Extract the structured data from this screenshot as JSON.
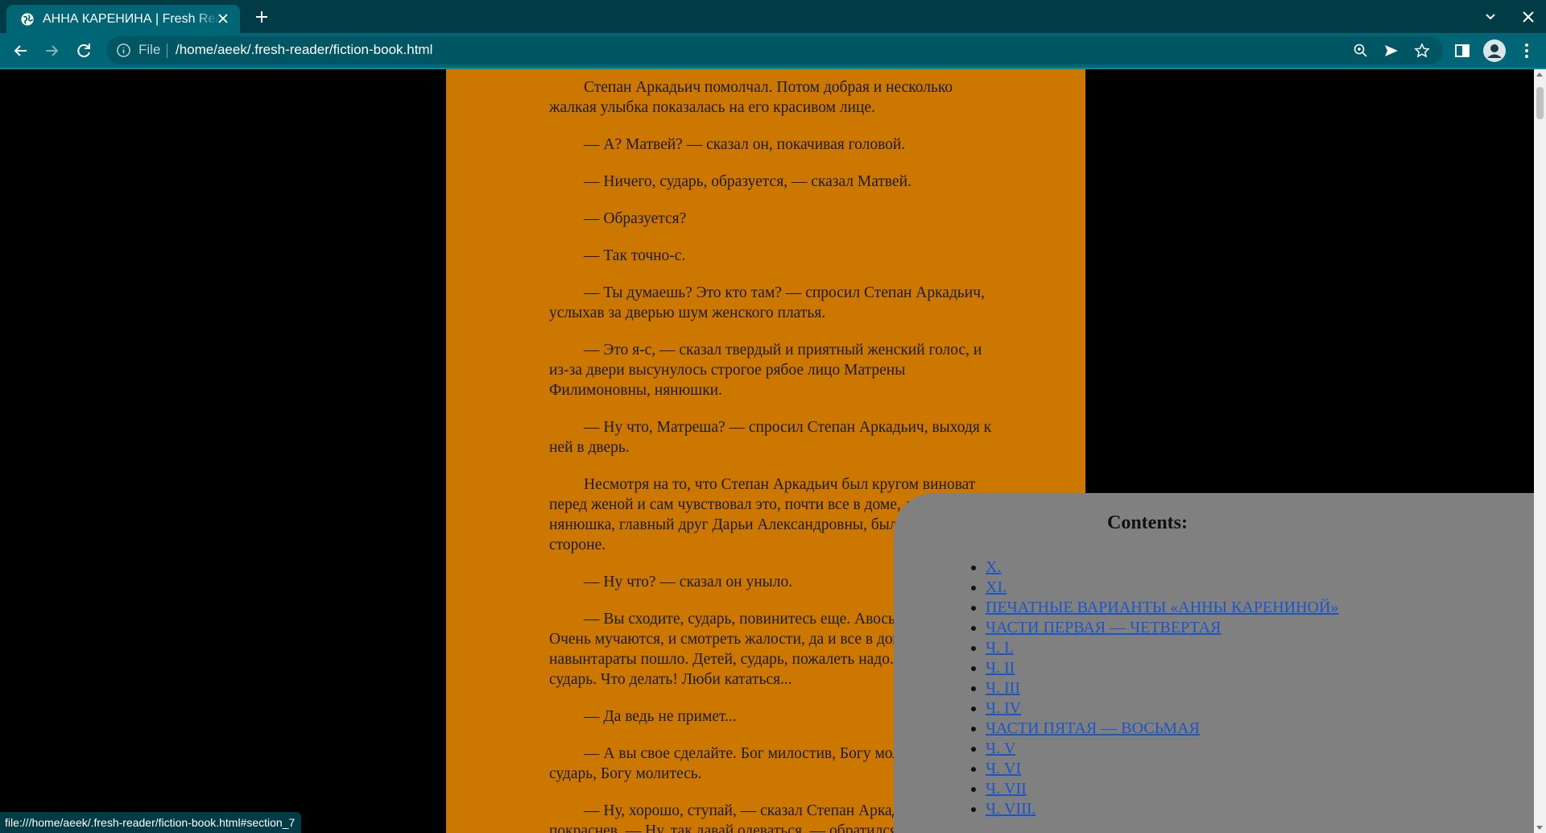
{
  "browser": {
    "tab_title": "АННА КАРЕНИНА | Fresh Reader",
    "address_scheme": "File",
    "address_url": "/home/aeek/.fresh-reader/fiction-book.html",
    "status_url": "file:///home/aeek/.fresh-reader/fiction-book.html#section_7"
  },
  "book": {
    "paragraphs": [
      "Степан Аркадьич помолчал. Потом добрая и несколько жалкая улыбка показалась на его красивом лице.",
      "— А? Матвей? — сказал он, покачивая головой.",
      "— Ничего, сударь, образуется, — сказал Матвей.",
      "— Образуется?",
      "— Так точно-с.",
      "— Ты думаешь? Это кто там? — спросил Степан Аркадьич, услыхав за дверью шум женского платья.",
      "— Это я-с, — сказал твердый и приятный женский голос, и из-за двери высунулось строгое рябое лицо Матрены Филимоновны, нянюшки.",
      "— Ну что, Матреша? — спросил Степан Аркадьич, выходя к ней в дверь.",
      "Несмотря на то, что Степан Аркадьич был кругом виноват перед женой и сам чувствовал это, почти все в доме, даже нянюшка, главный друг Дарьи Александровны, были на его стороне.",
      "— Ну что? — сказал он уныло.",
      "— Вы сходите, сударь, повинитесь еще. Авось бог даст. Очень мучаются, и смотреть жалости, да и все в доме навынтараты пошло. Детей, сударь, пожалеть надо. Повинитесь, сударь. Что делать! Люби кататься...",
      "— Да ведь не примет...",
      "— А вы свое сделайте. Бог милостив, Богу молитесь, сударь, Богу молитесь.",
      "— Ну, хорошо, ступай, — сказал Степан Аркадьич, вдруг покраснев. — Ну, так давай одеваться, — обратился он к Матвею."
    ]
  },
  "toc": {
    "title": "Contents:",
    "items": [
      "X.",
      "XI.",
      "ПЕЧАТНЫЕ ВАРИАНТЫ «АННЫ КАРЕНИНОЙ»",
      "ЧАСТИ ПЕРВАЯ — ЧЕТВЕРТАЯ",
      "Ч. I.",
      "Ч. II",
      "Ч. III",
      "Ч. IV",
      "ЧАСТИ ПЯТАЯ — ВОСЬМАЯ",
      "Ч. V",
      "Ч. VI",
      "Ч. VII",
      "Ч. VIII."
    ]
  },
  "colors": {
    "tabstrip": "#003b46",
    "toolbar": "#006675",
    "page_column": "#cc7700",
    "toc_panel": "#808080",
    "link": "#1a56c8"
  },
  "icons": {
    "favicon": "globe-icon",
    "back": "arrow-left-icon",
    "forward": "arrow-right-icon",
    "reload": "reload-icon",
    "zoom": "zoom-icon",
    "send": "send-icon",
    "bookmark": "star-icon",
    "side_panel": "side-panel-icon",
    "profile": "profile-icon",
    "menu": "kebab-menu-icon"
  }
}
